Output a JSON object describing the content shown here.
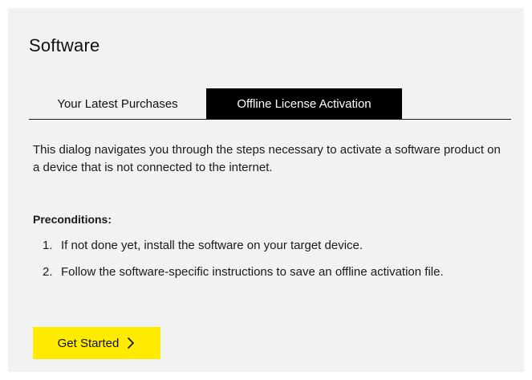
{
  "dialog": {
    "title": "Software"
  },
  "tabs": [
    {
      "label": "Your Latest Purchases",
      "active": false
    },
    {
      "label": "Offline License Activation",
      "active": true
    }
  ],
  "content": {
    "intro": "This dialog navigates you through the steps necessary to activate a software product on a device that is not connected to the internet.",
    "preconditions_heading": "Preconditions:",
    "steps": [
      {
        "number": "1.",
        "text": "If not done yet, install the software on your target device."
      },
      {
        "number": "2.",
        "text": "Follow the software-specific instructions to save an offline activation file."
      }
    ]
  },
  "actions": {
    "get_started_label": "Get Started",
    "get_started_icon": "chevron-right-icon"
  },
  "colors": {
    "panel_background": "#f2f2f2",
    "active_tab_background": "#000000",
    "active_tab_text": "#ffffff",
    "primary_button": "#ffeb00"
  }
}
